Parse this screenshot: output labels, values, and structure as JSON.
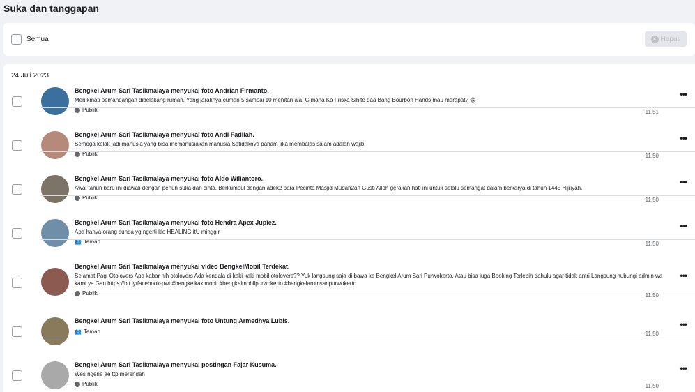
{
  "page": {
    "title": "Suka dan tanggapan"
  },
  "toolbar": {
    "select_all_label": "Semua",
    "delete_label": "Hapus"
  },
  "list": {
    "date": "24 Juli 2023",
    "items": [
      {
        "title": "Bengkel Arum Sari Tasikmalaya menyukai foto Andrian Firmanto.",
        "text": "Menikmati pemandangan dibelakang rumah. Yang jaraknya cuman 5 sampai 10 menitan aja. Gimana Ka Friska Sihite daa Bang Bourbon Hands mau merapat? 😁",
        "privacy": "Publik",
        "privacy_icon": "globe-icon",
        "time": "11.51",
        "avatar_color": "#3a6f9e"
      },
      {
        "title": "Bengkel Arum Sari Tasikmalaya menyukai foto Andi Fadilah.",
        "text": "Semoga kelak jadi manusia yang bisa memanusiakan manusia Setidaknya paham jika membalas salam adalah wajib",
        "privacy": "Publik",
        "privacy_icon": "globe-icon",
        "time": "11.50",
        "avatar_color": "#b58a7a"
      },
      {
        "title": "Bengkel Arum Sari Tasikmalaya menyukai foto Aldo Wiliantoro.",
        "text": "Awal tahun baru ini diawali dengan penuh suka dan cinta. Berkumpul dengan adek2 para Pecinta Masjid Mudah2an Gusti Alloh gerakan hati ini untuk selalu semangat dalam berkarya di tahun 1445 Hijriyah.",
        "privacy": "Publik",
        "privacy_icon": "globe-icon",
        "time": "11.50",
        "avatar_color": "#7d7468"
      },
      {
        "title": "Bengkel Arum Sari Tasikmalaya menyukai foto Hendra Apex Jupiez.",
        "text": "Apa hanya orang sunda yg ngerti klo HEALING itU minggir",
        "privacy": "Teman",
        "privacy_icon": "friends-icon",
        "time": "11.50",
        "avatar_color": "#6f8fa8"
      },
      {
        "title": "Bengkel Arum Sari Tasikmalaya menyukai video BengkelMobil Terdekat.",
        "text": "Selamat Pagi Otolovers Apa kabar nih otolovers Ada kendala di kaki-kaki mobil otolovers?? Yuk langsung saja di bawa ke Bengkel Arum Sari Purwokerto, Atau bisa juga Booking Terlebih dahulu agar tidak antri Langsung hubungi admin wa kami ya Gan https://bit.ly/facebook-pwt #bengkelkakimobil #bengkelmobilpurwokerto #bengkelarumsaripurwokerto",
        "privacy": "Publik",
        "privacy_icon": "globe-icon",
        "time": "11.50",
        "avatar_color": "#8c5a4e"
      },
      {
        "title": "Bengkel Arum Sari Tasikmalaya menyukai foto Untung Armedhya Lubis.",
        "text": "",
        "privacy": "Teman",
        "privacy_icon": "friends-icon",
        "time": "11.50",
        "avatar_color": "#8a7a5c"
      },
      {
        "title": "Bengkel Arum Sari Tasikmalaya menyukai postingan Fajar Kusuma.",
        "text": "Wes ngene ae ttp merendah",
        "privacy": "Publik",
        "privacy_icon": "globe-icon",
        "time": "11.50",
        "avatar_color": "#a9a9a9"
      }
    ]
  },
  "icons": {
    "more": "more-options-icon",
    "delete": "close-circle-icon"
  }
}
